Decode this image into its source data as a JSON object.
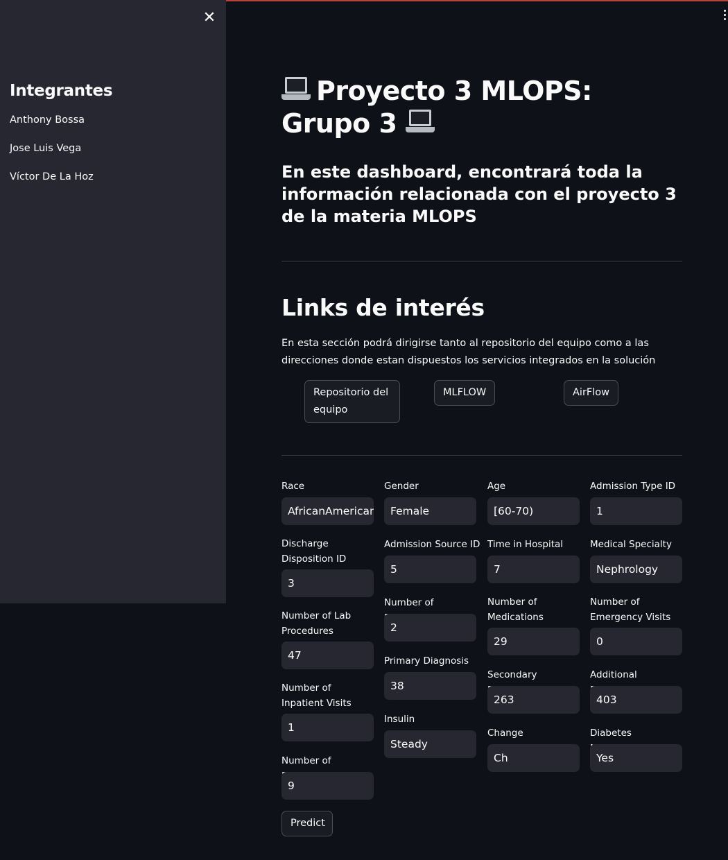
{
  "sidebar": {
    "close_glyph": "✕",
    "title": "Integrantes",
    "members": [
      "Anthony Bossa",
      "Jose Luis Vega",
      "Víctor De La Hoz"
    ]
  },
  "header": {
    "title": "Proyecto 3 MLOPS: Grupo 3",
    "title_icon": "laptop-icon",
    "subtitle": "En este dashboard, encontrará toda la información relacionada con el proyecto 3 de la materia MLOPS"
  },
  "links": {
    "title": "Links de interés",
    "description": "En esta sección podrá dirigirse tanto al repositorio del equipo como a las direcciones donde estan dispuestos los servicios integrados en la solución",
    "repo_label": "Repositorio del equipo",
    "mlflow_label": "MLFLOW",
    "airflow_label": "AirFlow"
  },
  "form": {
    "fields": [
      {
        "label": "Race",
        "value": "AfricanAmerican"
      },
      {
        "label": "Gender",
        "value": "Female"
      },
      {
        "label": "Age",
        "value": "[60-70)"
      },
      {
        "label": "Admission Type ID",
        "value": "1"
      },
      {
        "label": "Discharge Disposition ID",
        "value": "3"
      },
      {
        "label": "Admission Source ID",
        "value": "5"
      },
      {
        "label": "Time in Hospital",
        "value": "7"
      },
      {
        "label": "Medical Specialty",
        "value": "Nephrology"
      },
      {
        "label": "Number of Lab Procedures",
        "value": "47"
      },
      {
        "label": "Number of Procedures",
        "value": "2"
      },
      {
        "label": "Number of Medications",
        "value": "29"
      },
      {
        "label": "Number of Emergency Visits",
        "value": "0"
      },
      {
        "label": "Primary Diagnosis",
        "value": "38"
      },
      {
        "label": "Secondary Diagnosis",
        "value": "263"
      },
      {
        "label": "Additional Diagnosis",
        "value": "403"
      },
      {
        "label": "Number of Inpatient Visits",
        "value": "1"
      },
      {
        "label": "Insulin",
        "value": "Steady"
      },
      {
        "label": "Change",
        "value": "Ch"
      },
      {
        "label": "Diabetes Medication",
        "value": "Yes"
      },
      {
        "label": "Number of Diagnoses",
        "value": "9"
      }
    ],
    "predict_label": "Predict"
  },
  "colors": {
    "background": "#0e1117",
    "sidebar": "#262730",
    "input": "#262730",
    "top_accent": "#b8433c"
  }
}
